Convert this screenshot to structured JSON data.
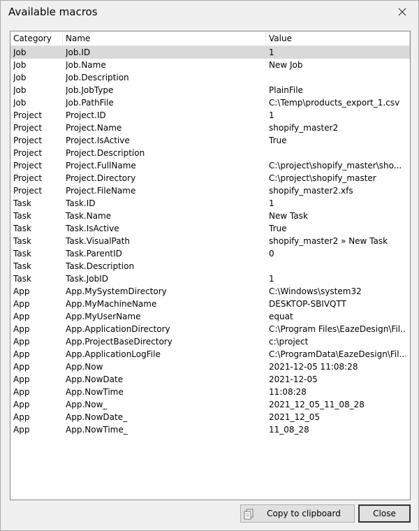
{
  "window": {
    "title": "Available macros"
  },
  "table": {
    "columns": [
      "Category",
      "Name",
      "Value"
    ],
    "rows": [
      {
        "category": "Job",
        "name": "Job.ID",
        "value": "1"
      },
      {
        "category": "Job",
        "name": "Job.Name",
        "value": "New Job"
      },
      {
        "category": "Job",
        "name": "Job.Description",
        "value": ""
      },
      {
        "category": "Job",
        "name": "Job.JobType",
        "value": "PlainFile"
      },
      {
        "category": "Job",
        "name": "Job.PathFile",
        "value": "C:\\Temp\\products_export_1.csv"
      },
      {
        "category": "Project",
        "name": "Project.ID",
        "value": "1"
      },
      {
        "category": "Project",
        "name": "Project.Name",
        "value": "shopify_master2"
      },
      {
        "category": "Project",
        "name": "Project.IsActive",
        "value": "True"
      },
      {
        "category": "Project",
        "name": "Project.Description",
        "value": ""
      },
      {
        "category": "Project",
        "name": "Project.FullName",
        "value": "C:\\project\\shopify_master\\sho..."
      },
      {
        "category": "Project",
        "name": "Project.Directory",
        "value": "C:\\project\\shopify_master"
      },
      {
        "category": "Project",
        "name": "Project.FileName",
        "value": "shopify_master2.xfs"
      },
      {
        "category": "Task",
        "name": "Task.ID",
        "value": "1"
      },
      {
        "category": "Task",
        "name": "Task.Name",
        "value": "New Task"
      },
      {
        "category": "Task",
        "name": "Task.IsActive",
        "value": "True"
      },
      {
        "category": "Task",
        "name": "Task.VisualPath",
        "value": "shopify_master2 » New Task"
      },
      {
        "category": "Task",
        "name": "Task.ParentID",
        "value": "0"
      },
      {
        "category": "Task",
        "name": "Task.Description",
        "value": ""
      },
      {
        "category": "Task",
        "name": "Task.JobID",
        "value": "1"
      },
      {
        "category": "App",
        "name": "App.MySystemDirectory",
        "value": "C:\\Windows\\system32"
      },
      {
        "category": "App",
        "name": "App.MyMachineName",
        "value": "DESKTOP-SBIVQTT"
      },
      {
        "category": "App",
        "name": "App.MyUserName",
        "value": "equat"
      },
      {
        "category": "App",
        "name": "App.ApplicationDirectory",
        "value": "C:\\Program Files\\EazeDesign\\Fil..."
      },
      {
        "category": "App",
        "name": "App.ProjectBaseDirectory",
        "value": "c:\\project"
      },
      {
        "category": "App",
        "name": "App.ApplicationLogFile",
        "value": "C:\\ProgramData\\EazeDesign\\Fil..."
      },
      {
        "category": "App",
        "name": "App.Now",
        "value": "2021-12-05 11:08:28"
      },
      {
        "category": "App",
        "name": "App.NowDate",
        "value": "2021-12-05"
      },
      {
        "category": "App",
        "name": "App.NowTime",
        "value": "11:08:28"
      },
      {
        "category": "App",
        "name": "App.Now_",
        "value": "2021_12_05_11_08_28"
      },
      {
        "category": "App",
        "name": "App.NowDate_",
        "value": "2021_12_05"
      },
      {
        "category": "App",
        "name": "App.NowTime_",
        "value": "11_08_28"
      }
    ]
  },
  "buttons": {
    "copy_label": "Copy to clipboard",
    "close_label": "Close"
  },
  "icons": {
    "close": "close-icon",
    "copy": "copy-icon"
  }
}
